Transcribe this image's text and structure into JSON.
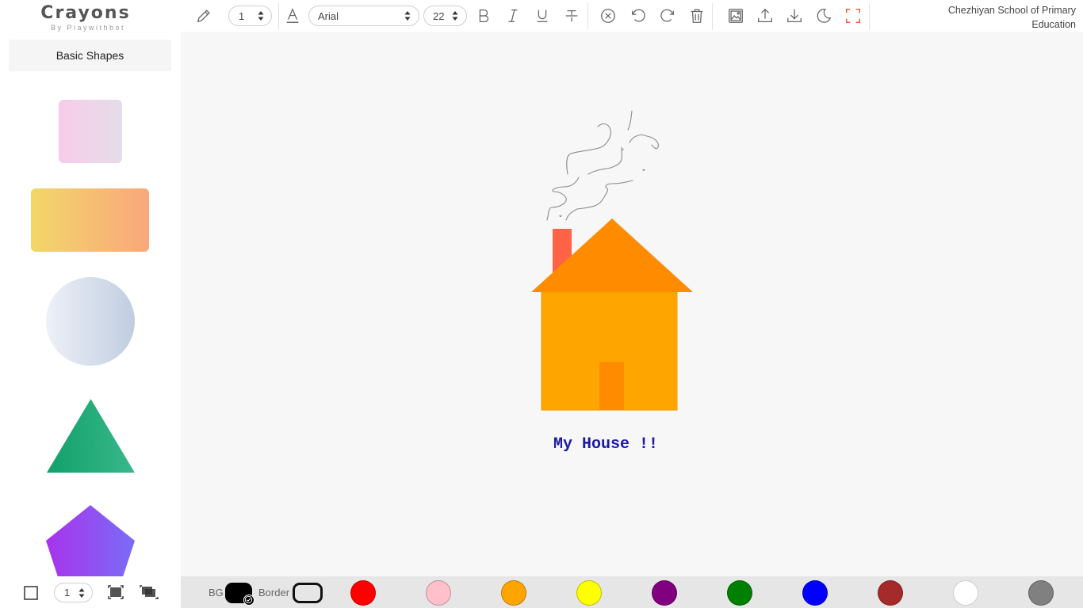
{
  "app": {
    "logo_title": "Crayons",
    "logo_subtitle": "By Playwithbot",
    "school_name": "Chezhiyan School of Primary Education"
  },
  "toolbar": {
    "pen_size": "1",
    "font_family": "Arial",
    "font_size": "22",
    "icons": [
      "pencil-icon",
      "font-color-icon",
      "bold-icon",
      "italic-icon",
      "underline-icon",
      "strikethrough-icon",
      "clear-icon",
      "undo-icon",
      "redo-icon",
      "trash-icon",
      "image-icon",
      "upload-icon",
      "download-icon",
      "dark-mode-icon",
      "fullscreen-icon"
    ],
    "fullscreen_color": "#e8633a"
  },
  "sidebar": {
    "tab_label": "Basic Shapes",
    "shapes": [
      {
        "name": "square",
        "colors": [
          "#f8cbe9",
          "#e5dde9"
        ]
      },
      {
        "name": "rectangle",
        "colors": [
          "#f2d76a",
          "#f9a77b"
        ]
      },
      {
        "name": "circle",
        "colors": [
          "#eef1f8",
          "#c0cde0"
        ]
      },
      {
        "name": "triangle",
        "colors": [
          "#12a06a",
          "#39b88c"
        ]
      },
      {
        "name": "pentagon",
        "colors": [
          "#a833ec",
          "#7a6cf7"
        ]
      }
    ]
  },
  "canvas": {
    "caption": "My House !!",
    "caption_color": "#1a1aa6",
    "house": {
      "roof_color": "#ff8c00",
      "wall_color": "#ffa500",
      "door_color": "#ff8c00",
      "chimney_color": "#ff6347",
      "smoke_color": "#8c8c8c"
    }
  },
  "bottom": {
    "border_size": "1",
    "bg_label": "BG",
    "border_label": "Border",
    "bg_color": "#000000",
    "palette": [
      {
        "name": "red",
        "hex": "#ff0000"
      },
      {
        "name": "pink",
        "hex": "#ffc0cb"
      },
      {
        "name": "orange",
        "hex": "#ffa500"
      },
      {
        "name": "yellow",
        "hex": "#ffff00"
      },
      {
        "name": "purple",
        "hex": "#800080"
      },
      {
        "name": "green",
        "hex": "#008000"
      },
      {
        "name": "blue",
        "hex": "#0000ff"
      },
      {
        "name": "brown",
        "hex": "#a52a2a"
      },
      {
        "name": "white",
        "hex": "#ffffff"
      },
      {
        "name": "gray",
        "hex": "#808080"
      }
    ]
  }
}
